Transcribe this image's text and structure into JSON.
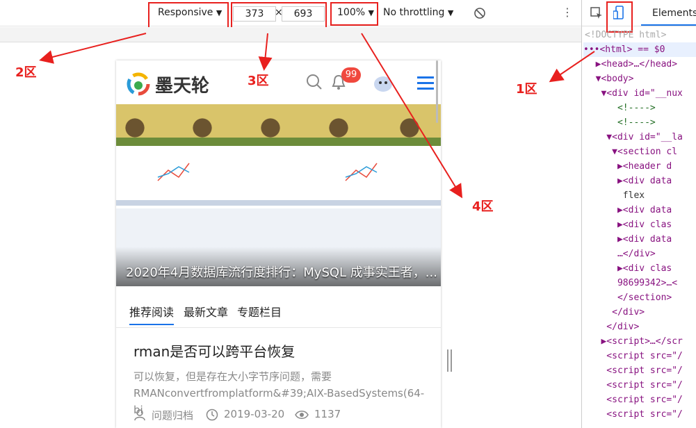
{
  "toolbar": {
    "device": "Responsive",
    "width": "373",
    "times": "×",
    "height": "693",
    "zoom": "100%",
    "throttle": "No throttling"
  },
  "devtools": {
    "tab_elements": "Elements",
    "lines": [
      "<!DOCTYPE html>",
      "•••<html> == $0",
      "  ▶<head>…</head>",
      "  ▼<body>",
      "   ▼<div id=\"__nux",
      "      <!---->",
      "      <!---->",
      "    ▼<div id=\"__la",
      "     ▼<section cl",
      "      ▶<header d",
      "      ▶<div data",
      "       flex",
      "      ▶<div data",
      "      ▶<div clas",
      "      ▶<div data",
      "      …</div>",
      "      ▶<div clas",
      "      98699342>…<",
      "      </section>",
      "     </div>",
      "    </div>",
      "   ▶<script>…</scr",
      "    <script src=\"/",
      "    <script src=\"/",
      "    <script src=\"/",
      "    <script src=\"/",
      "    <script src=\"/"
    ]
  },
  "site": {
    "logo": "墨天轮",
    "notif_count": "99",
    "banner_title": "2020年4月数据库流行度排行：MySQL 成事实王者，...",
    "tabs": [
      "推荐阅读",
      "最新文章",
      "专题栏目"
    ],
    "article": {
      "title": "rman是否可以跨平台恢复",
      "desc": "可以恢复，但是存在大小字节序问题，需要RMANconvertfromplatform&#39;AIX-BasedSystems(64-bi",
      "author": "问题归档",
      "date": "2019-03-20",
      "views": "1137"
    }
  },
  "annotations": {
    "zone1": "1区",
    "zone2": "2区",
    "zone3": "3区",
    "zone4": "4区"
  },
  "colors": {
    "annotation_red": "#e8201e",
    "accent_blue": "#1a73e8"
  }
}
